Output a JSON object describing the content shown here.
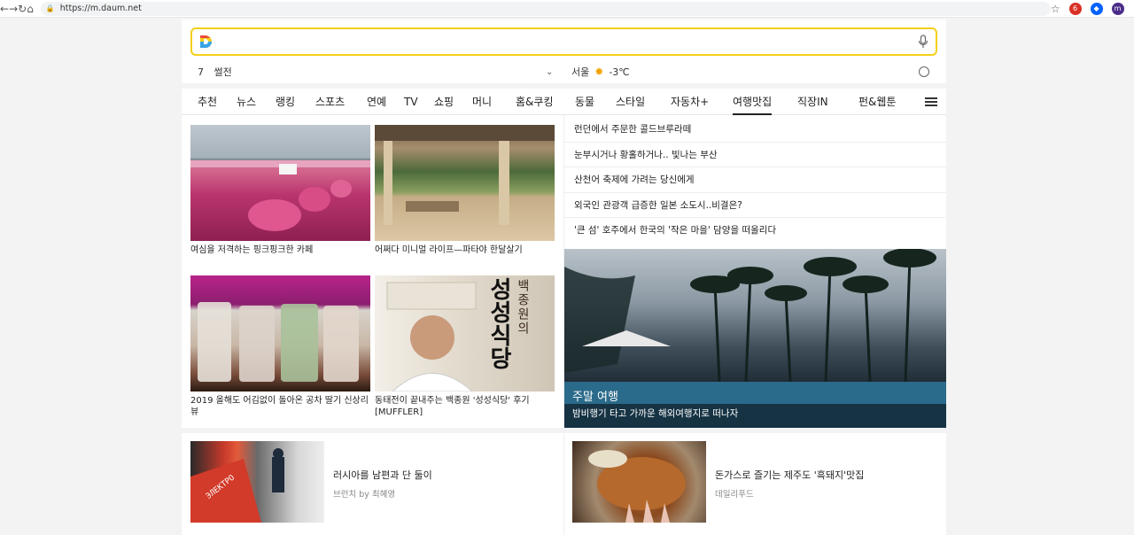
{
  "browser": {
    "url": "https://m.daum.net",
    "nav": {
      "back": "←",
      "forward": "→",
      "reload": "↻",
      "home": "⌂"
    },
    "star": "☆",
    "extension_badge": "6",
    "profile_initial": "m"
  },
  "search": {
    "placeholder": "",
    "logo_letter": "D"
  },
  "subbar": {
    "rank_number": "7",
    "rank_keyword": "썰전",
    "chevron": "⌄",
    "city": "서울",
    "temperature": "-3℃"
  },
  "nav": {
    "tabs": [
      {
        "label": "추천"
      },
      {
        "label": "뉴스"
      },
      {
        "label": "랭킹"
      },
      {
        "label": "스포츠"
      },
      {
        "label": "연예"
      },
      {
        "label": "TV"
      },
      {
        "label": "쇼핑"
      },
      {
        "label": "머니"
      },
      {
        "label": "홈&쿠킹"
      },
      {
        "label": "동물"
      },
      {
        "label": "스타일"
      },
      {
        "label": "자동차+"
      },
      {
        "label": "여행맛집"
      },
      {
        "label": "직장IN"
      },
      {
        "label": "펀&웹툰"
      }
    ],
    "active_tab": "여행맛집"
  },
  "cards": [
    {
      "caption": "여심을 저격하는 핑크핑크한 카페"
    },
    {
      "caption": "어쩌다 미니멀 라이프—파타야 한달살기"
    },
    {
      "caption": "2019 올해도 어김없이 돌아온 공차 딸기 신상리뷰"
    },
    {
      "caption": "동태전이 끝내주는 백종원 '성성식당' 후기 [MUFFLER]"
    }
  ],
  "chef_sign": {
    "name": "백종원의",
    "shop": "성성식당"
  },
  "headlines": [
    "런던에서 주문한 콜드브루라떼",
    "눈부시거나 황홀하거나.. 빛나는 부산",
    "산천어 축제에 가려는 당신에게",
    "외국인 관광객 급증한 일본 소도시..비결은?",
    "'큰 섬' 호주에서 한국의 '작은 마을' 담양을 떠올리다"
  ],
  "feature": {
    "title": "주말 여행",
    "subtitle": "밤비행기 타고 가까운 해외여행지로 떠나자"
  },
  "bottom": [
    {
      "title": "러시아를 남편과 단 둘이",
      "source": "브런치 by 최혜영",
      "thumb_text": "ЭЛЕКТРО"
    },
    {
      "title": "돈가스로 즐기는 제주도 '흑돼지'맛집",
      "source": "데일리푸드"
    }
  ],
  "colors": {
    "search_border": "#f4cf1b",
    "page_bg": "#f3f3f3"
  }
}
